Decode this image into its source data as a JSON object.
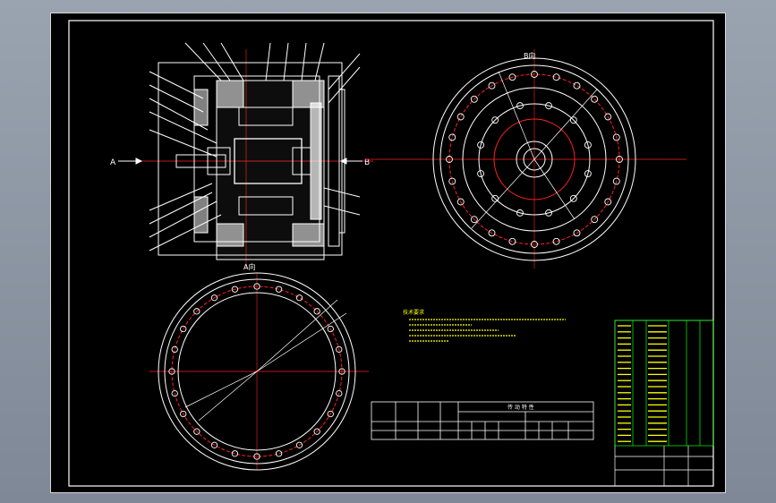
{
  "drawing": {
    "section_label_left": "A",
    "section_label_right": "B",
    "view_label": "A向",
    "view_label_side": "B向",
    "note_heading": "技术要求",
    "param_table_title": "传 动 特 性"
  },
  "colors": {
    "background": "#000000",
    "frame": "#ffffff",
    "centerline": "#ff2020",
    "text": "#ffff00",
    "hatch": "#ffffff",
    "title_block": "#00ff00"
  }
}
